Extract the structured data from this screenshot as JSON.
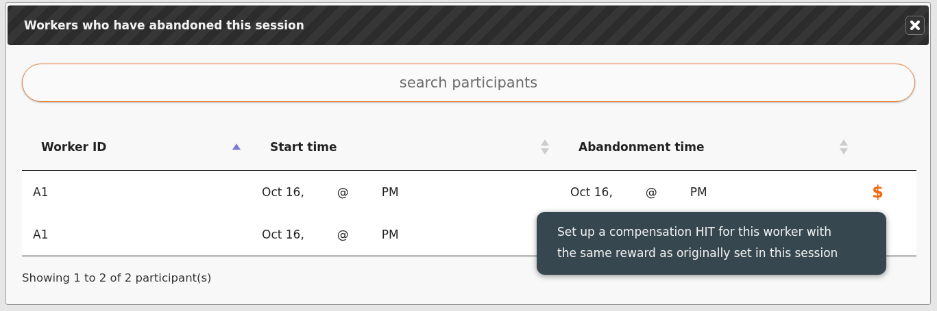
{
  "dialog": {
    "title": "Workers who have abandoned this session"
  },
  "search": {
    "placeholder": "search participants"
  },
  "table": {
    "columns": [
      {
        "label": "Worker ID",
        "sorted_ascending": true
      },
      {
        "label": "Start time",
        "sorted_ascending": false
      },
      {
        "label": "Abandonment time",
        "sorted_ascending": false
      }
    ],
    "rows": [
      {
        "worker_id": [
          "A1"
        ],
        "start_time": [
          "Oct 16,",
          "@",
          "PM"
        ],
        "abandonment_time": [
          "Oct 16,",
          "@",
          "PM"
        ],
        "action": "$"
      },
      {
        "worker_id": [
          "A1"
        ],
        "start_time": [
          "Oct 16,",
          "@",
          "PM"
        ]
      }
    ]
  },
  "footer": {
    "info": "Showing 1 to 2 of 2 participant(s)"
  },
  "tooltip": {
    "text": "Set up a compensation HIT for this worker with the same reward as originally set in this session"
  }
}
